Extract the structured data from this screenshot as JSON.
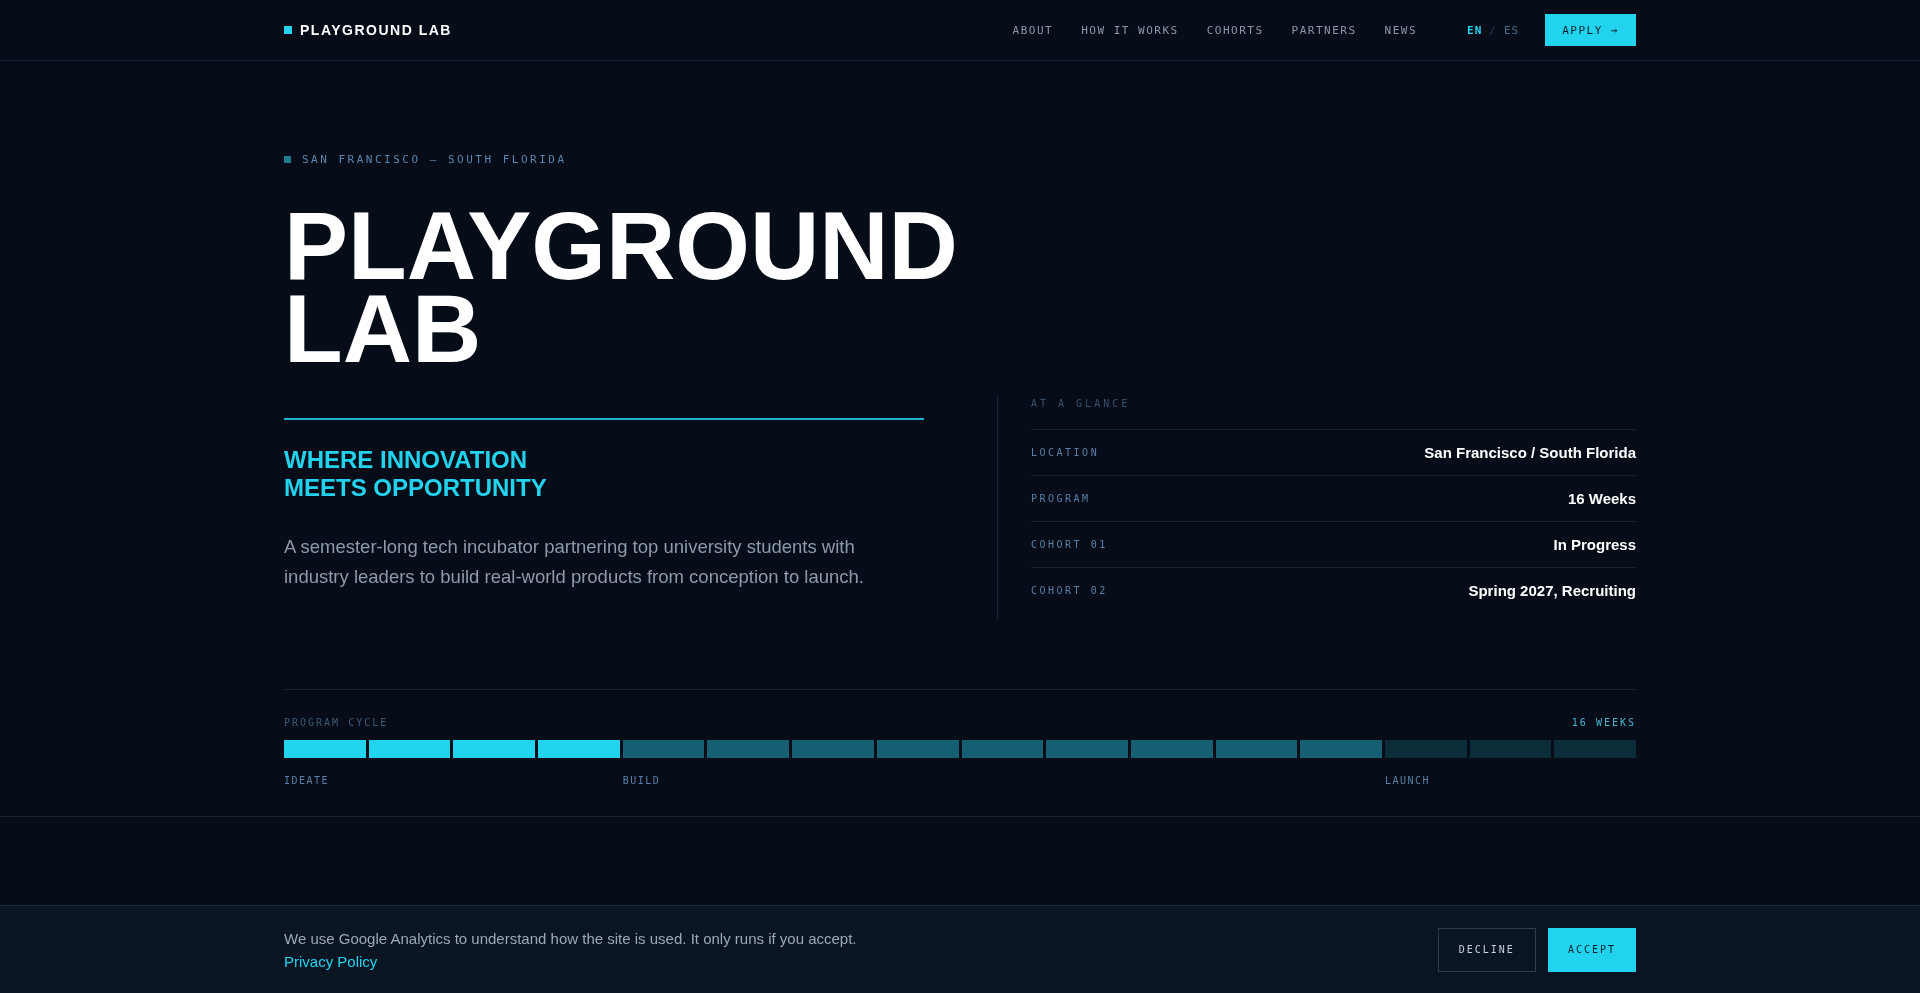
{
  "nav": {
    "brand": "PLAYGROUND LAB",
    "links": [
      "ABOUT",
      "HOW IT WORKS",
      "COHORTS",
      "PARTNERS",
      "NEWS"
    ],
    "languages": [
      {
        "label": "EN",
        "selected": true
      },
      {
        "label": "ES",
        "selected": false
      }
    ],
    "separator": "/",
    "cta": "APPLY →"
  },
  "hero": {
    "eyebrow": "SAN FRANCISCO — SOUTH FLORIDA",
    "title_lines": [
      "PLAYGROUND",
      "LAB"
    ],
    "tagline_lines": [
      "WHERE INNOVATION",
      "MEETS OPPORTUNITY"
    ],
    "description": "A semester-long tech incubator partnering top university students with industry leaders to build real-world products from conception to launch."
  },
  "glance": {
    "heading": "AT A GLANCE",
    "rows": [
      {
        "label": "LOCATION",
        "value": "San Francisco / South Florida"
      },
      {
        "label": "PROGRAM",
        "value": "16 Weeks"
      },
      {
        "label": "COHORT 01",
        "value": "In Progress"
      },
      {
        "label": "COHORT 02",
        "value": "Spring 2027, Recruiting"
      }
    ]
  },
  "program_cycle": {
    "title": "PROGRAM CYCLE",
    "duration": "16 WEEKS",
    "segments": [
      {
        "kind": "done",
        "label": "IDEATE"
      },
      {
        "kind": "done"
      },
      {
        "kind": "done"
      },
      {
        "kind": "done"
      },
      {
        "kind": "current",
        "label": "BUILD"
      },
      {
        "kind": "current"
      },
      {
        "kind": "current"
      },
      {
        "kind": "current"
      },
      {
        "kind": "current"
      },
      {
        "kind": "current"
      },
      {
        "kind": "current"
      },
      {
        "kind": "current"
      },
      {
        "kind": "current"
      },
      {
        "kind": "upcoming",
        "label": "LAUNCH"
      },
      {
        "kind": "upcoming"
      },
      {
        "kind": "upcoming"
      }
    ]
  },
  "cookie_banner": {
    "text": "We use Google Analytics to understand how the site is used. It only runs if you accept.",
    "link": "Privacy Policy",
    "buttons": [
      {
        "label": "DECLINE",
        "kind": "secondary"
      },
      {
        "label": "ACCEPT",
        "kind": "primary"
      }
    ]
  }
}
